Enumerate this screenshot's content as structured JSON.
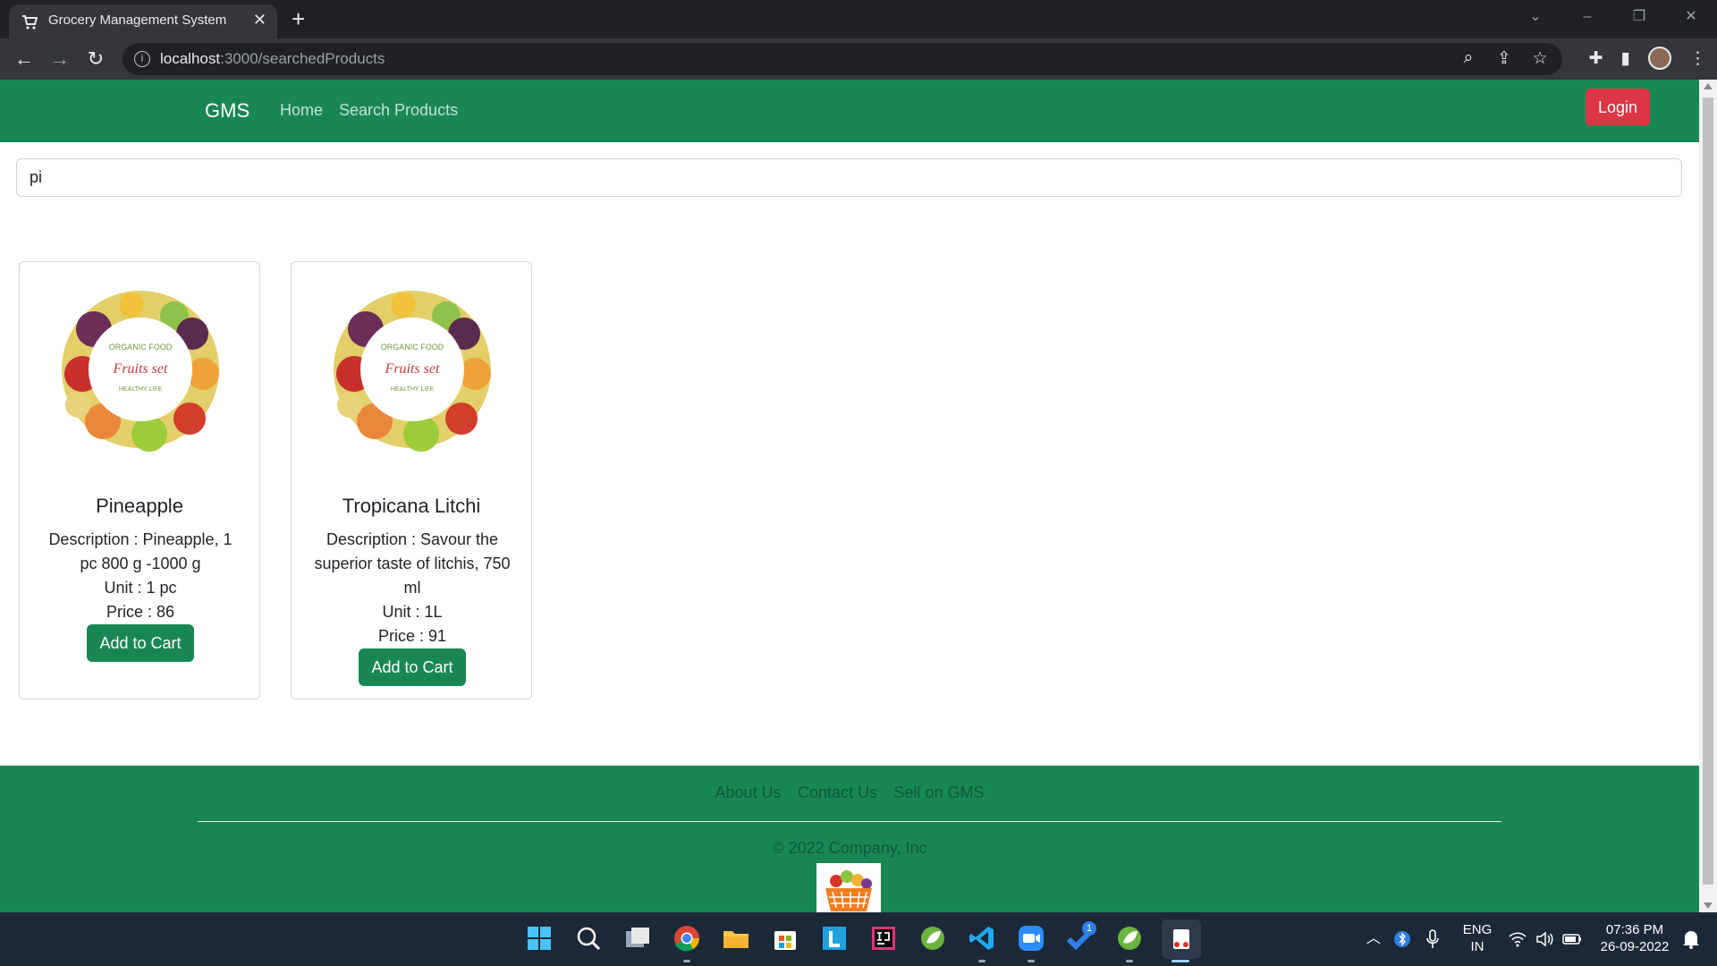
{
  "browser": {
    "tab_title": "Grocery Management System",
    "url_host": "localhost",
    "url_rest": ":3000/searchedProducts"
  },
  "navbar": {
    "brand": "GMS",
    "links": [
      "Home",
      "Search Products"
    ],
    "login_label": "Login"
  },
  "search": {
    "value": "pi"
  },
  "products": [
    {
      "name": "Pineapple",
      "description": "Description : Pineapple, 1 pc 800 g -1000 g",
      "unit": "Unit : 1 pc",
      "price": "Price : 86",
      "button": "Add to Cart"
    },
    {
      "name": "Tropicana Litchi",
      "description": "Description : Savour the superior taste of litchis, 750 ml",
      "unit": "Unit : 1L",
      "price": "Price : 91",
      "button": "Add to Cart"
    }
  ],
  "product_image_text": {
    "top": "ORGANIC FOOD",
    "middle": "Fruits set",
    "bottom": "HEALTHY LIFE"
  },
  "footer": {
    "links": [
      "About Us",
      "Contact Us",
      "Sell on GMS"
    ],
    "copyright": "© 2022 Company, Inc"
  },
  "taskbar": {
    "language": "ENG",
    "region": "IN",
    "time": "07:36 PM",
    "date": "26-09-2022",
    "badge_count": "1",
    "apps": [
      "windows-start-icon",
      "search-icon",
      "task-view-icon",
      "chrome-icon",
      "file-explorer-icon",
      "microsoft-store-icon",
      "l-app-icon",
      "intellij-icon",
      "spring-tool-icon",
      "vscode-icon",
      "zoom-icon",
      "todo-icon",
      "spring-boot-icon",
      "snipping-tool-icon"
    ]
  },
  "colors": {
    "primary": "#198754",
    "danger": "#dc3545",
    "chrome_dark": "#202124",
    "taskbar": "#1b2838"
  }
}
